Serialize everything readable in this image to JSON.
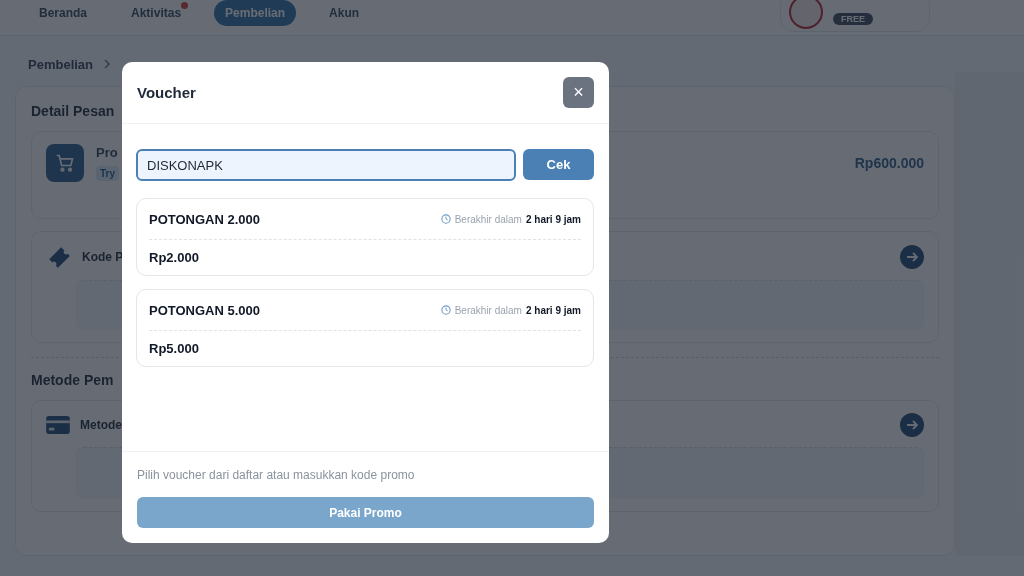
{
  "nav": {
    "tabs": [
      {
        "label": "Beranda",
        "selected": false,
        "badge": false
      },
      {
        "label": "Aktivitas",
        "selected": false,
        "badge": true
      },
      {
        "label": "Pembelian",
        "selected": true,
        "badge": false
      },
      {
        "label": "Akun",
        "selected": false,
        "badge": false
      }
    ],
    "user": {
      "plan": "FREE"
    }
  },
  "breadcrumb": {
    "items": [
      "Pembelian"
    ]
  },
  "order": {
    "title": "Detail Pesan",
    "product": {
      "name": "Pro",
      "tag": "Try",
      "price": "Rp600.000"
    },
    "promo": {
      "label": "Kode P"
    },
    "payment_title": "Metode Pem",
    "payment": {
      "label": "Metode"
    }
  },
  "modal": {
    "title": "Voucher",
    "close": "×",
    "code_field": {
      "value": "DISKONAPK"
    },
    "check_button": "Cek",
    "vouchers": [
      {
        "name": "POTONGAN 2.000",
        "expiry_label": "Berakhir dalam",
        "expiry_value": "2 hari 9 jam",
        "amount": "Rp2.000"
      },
      {
        "name": "POTONGAN 5.000",
        "expiry_label": "Berakhir dalam",
        "expiry_value": "2 hari 9 jam",
        "amount": "Rp5.000"
      }
    ],
    "hint": "Pilih voucher dari daftar atau masukkan kode promo",
    "apply_button": {
      "label": "Pakai Promo",
      "disabled": true
    }
  }
}
